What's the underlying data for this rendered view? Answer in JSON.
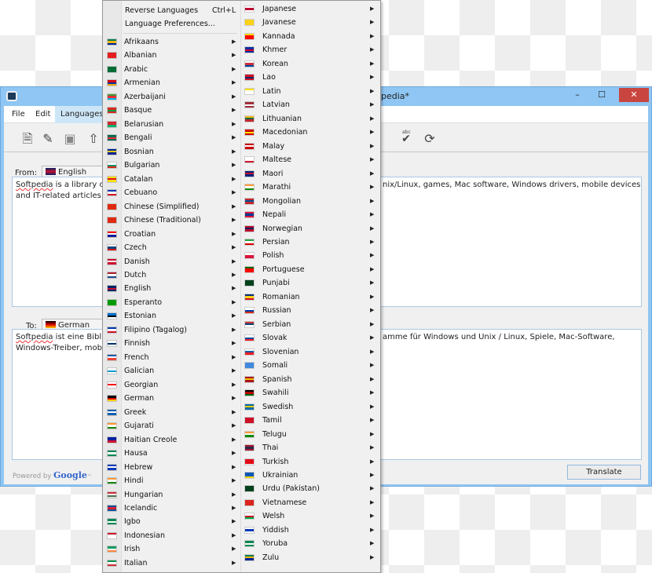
{
  "window": {
    "title": "pedia*",
    "minimize": "–",
    "maximize": "☐",
    "close": "✕"
  },
  "menubar": {
    "items": [
      "File",
      "Edit",
      "Languages"
    ],
    "active": "Languages"
  },
  "toolbar": {
    "icons": [
      "new-document-icon",
      "edit-document-icon",
      "save-icon",
      "export-icon",
      "spellcheck-icon",
      "refresh-icon"
    ],
    "spellcheck_label": "abc"
  },
  "source": {
    "label": "From:",
    "language": "English",
    "flag": [
      "#012169",
      "#c8102e",
      "#012169"
    ],
    "text_left": [
      "Softpedia",
      " is a library of"
    ],
    "text_left2": "and IT-related articles.",
    "text_right": "nix/Linux, games, Mac software, Windows drivers, mobile devices"
  },
  "target": {
    "label": "To:",
    "language": "German",
    "flag": [
      "#000000",
      "#dd0000",
      "#ffce00"
    ],
    "text_left": [
      "Softpedia",
      " ist eine Biblio"
    ],
    "text_left2": "Windows-Treiber, mobi",
    "text_right": "amme für Windows und Unix / Linux, Spiele, Mac-Software,"
  },
  "footer": {
    "powered_by": "Powered by",
    "google": "Google",
    "tm": "™",
    "translate": "Translate"
  },
  "menu": {
    "reverse": {
      "label": "Reverse Languages",
      "shortcut": "Ctrl+L"
    },
    "preferences": {
      "label": "Language Preferences..."
    },
    "left": [
      {
        "label": "Afrikaans",
        "flag": [
          "#007a4d",
          "#ffb612",
          "#002395"
        ]
      },
      {
        "label": "Albanian",
        "flag": [
          "#e41e20",
          "#e41e20",
          "#e41e20"
        ]
      },
      {
        "label": "Arabic",
        "flag": [
          "#006c35",
          "#006c35",
          "#006c35"
        ]
      },
      {
        "label": "Armenian",
        "flag": [
          "#d90012",
          "#0033a0",
          "#f2a800"
        ]
      },
      {
        "label": "Azerbaijani",
        "flag": [
          "#3f9c35",
          "#ed2939",
          "#00b9e4"
        ]
      },
      {
        "label": "Basque",
        "flag": [
          "#d52b1e",
          "#009b48",
          "#d52b1e"
        ]
      },
      {
        "label": "Belarusian",
        "flag": [
          "#d22730",
          "#d22730",
          "#00af66"
        ]
      },
      {
        "label": "Bengali",
        "flag": [
          "#006a4e",
          "#f42a41",
          "#006a4e"
        ]
      },
      {
        "label": "Bosnian",
        "flag": [
          "#002395",
          "#fecb00",
          "#002395"
        ]
      },
      {
        "label": "Bulgarian",
        "flag": [
          "#ffffff",
          "#00966e",
          "#d62612"
        ]
      },
      {
        "label": "Catalan",
        "flag": [
          "#fcdd09",
          "#da121a",
          "#fcdd09"
        ]
      },
      {
        "label": "Cebuano",
        "flag": [
          "#0038a8",
          "#ffffff",
          "#ce1126"
        ]
      },
      {
        "label": "Chinese (Simplified)",
        "flag": [
          "#de2910",
          "#de2910",
          "#de2910"
        ]
      },
      {
        "label": "Chinese (Traditional)",
        "flag": [
          "#de2910",
          "#de2910",
          "#de2910"
        ]
      },
      {
        "label": "Croatian",
        "flag": [
          "#ff0000",
          "#ffffff",
          "#171796"
        ]
      },
      {
        "label": "Czech",
        "flag": [
          "#ffffff",
          "#11457e",
          "#d7141a"
        ]
      },
      {
        "label": "Danish",
        "flag": [
          "#c8102e",
          "#ffffff",
          "#c8102e"
        ]
      },
      {
        "label": "Dutch",
        "flag": [
          "#ae1c28",
          "#ffffff",
          "#21468b"
        ]
      },
      {
        "label": "English",
        "flag": [
          "#012169",
          "#c8102e",
          "#012169"
        ]
      },
      {
        "label": "Esperanto",
        "flag": [
          "#009900",
          "#009900",
          "#009900"
        ]
      },
      {
        "label": "Estonian",
        "flag": [
          "#0072ce",
          "#000000",
          "#ffffff"
        ]
      },
      {
        "label": "Filipino (Tagalog)",
        "flag": [
          "#0038a8",
          "#ffffff",
          "#ce1126"
        ]
      },
      {
        "label": "Finnish",
        "flag": [
          "#ffffff",
          "#002f6c",
          "#ffffff"
        ]
      },
      {
        "label": "French",
        "flag": [
          "#0055a4",
          "#ffffff",
          "#ef4135"
        ]
      },
      {
        "label": "Galician",
        "flag": [
          "#ffffff",
          "#0099cc",
          "#ffffff"
        ]
      },
      {
        "label": "Georgian",
        "flag": [
          "#ffffff",
          "#ff0000",
          "#ffffff"
        ]
      },
      {
        "label": "German",
        "flag": [
          "#000000",
          "#dd0000",
          "#ffce00"
        ]
      },
      {
        "label": "Greek",
        "flag": [
          "#0d5eaf",
          "#ffffff",
          "#0d5eaf"
        ]
      },
      {
        "label": "Gujarati",
        "flag": [
          "#ff9933",
          "#ffffff",
          "#138808"
        ]
      },
      {
        "label": "Haitian Creole",
        "flag": [
          "#00209f",
          "#00209f",
          "#d21034"
        ]
      },
      {
        "label": "Hausa",
        "flag": [
          "#008751",
          "#ffffff",
          "#008751"
        ]
      },
      {
        "label": "Hebrew",
        "flag": [
          "#0038b8",
          "#ffffff",
          "#0038b8"
        ]
      },
      {
        "label": "Hindi",
        "flag": [
          "#ff9933",
          "#ffffff",
          "#138808"
        ]
      },
      {
        "label": "Hungarian",
        "flag": [
          "#ce2939",
          "#ffffff",
          "#477050"
        ]
      },
      {
        "label": "Icelandic",
        "flag": [
          "#02529c",
          "#dc1e35",
          "#02529c"
        ]
      },
      {
        "label": "Igbo",
        "flag": [
          "#008751",
          "#ffffff",
          "#008751"
        ]
      },
      {
        "label": "Indonesian",
        "flag": [
          "#ce1126",
          "#ffffff",
          "#ffffff"
        ]
      },
      {
        "label": "Irish",
        "flag": [
          "#169b62",
          "#ffffff",
          "#ff883e"
        ]
      },
      {
        "label": "Italian",
        "flag": [
          "#009246",
          "#ffffff",
          "#ce2b37"
        ]
      }
    ],
    "right": [
      {
        "label": "Japanese",
        "flag": [
          "#ffffff",
          "#bc002d",
          "#ffffff"
        ]
      },
      {
        "label": "Javanese",
        "flag": [
          "#fcd116",
          "#fcd116",
          "#fcd116"
        ]
      },
      {
        "label": "Kannada",
        "flag": [
          "#ffd700",
          "#ff0000",
          "#ff0000"
        ]
      },
      {
        "label": "Khmer",
        "flag": [
          "#032ea1",
          "#e00025",
          "#032ea1"
        ]
      },
      {
        "label": "Korean",
        "flag": [
          "#ffffff",
          "#cd2e3a",
          "#0047a0"
        ]
      },
      {
        "label": "Lao",
        "flag": [
          "#ce1126",
          "#002868",
          "#ce1126"
        ]
      },
      {
        "label": "Latin",
        "flag": [
          "#ffe000",
          "#ffffff",
          "#ffffff"
        ]
      },
      {
        "label": "Latvian",
        "flag": [
          "#9e3039",
          "#ffffff",
          "#9e3039"
        ]
      },
      {
        "label": "Lithuanian",
        "flag": [
          "#fdb913",
          "#006a44",
          "#c1272d"
        ]
      },
      {
        "label": "Macedonian",
        "flag": [
          "#d20000",
          "#ffe600",
          "#d20000"
        ]
      },
      {
        "label": "Malay",
        "flag": [
          "#cc0001",
          "#ffffff",
          "#cc0001"
        ]
      },
      {
        "label": "Maltese",
        "flag": [
          "#ffffff",
          "#ffffff",
          "#cf142b"
        ]
      },
      {
        "label": "Maori",
        "flag": [
          "#00247d",
          "#cc142b",
          "#00247d"
        ]
      },
      {
        "label": "Marathi",
        "flag": [
          "#ff9933",
          "#ffffff",
          "#138808"
        ]
      },
      {
        "label": "Mongolian",
        "flag": [
          "#c4272f",
          "#015197",
          "#c4272f"
        ]
      },
      {
        "label": "Nepali",
        "flag": [
          "#dc143c",
          "#003893",
          "#dc143c"
        ]
      },
      {
        "label": "Norwegian",
        "flag": [
          "#ba0c2f",
          "#00205b",
          "#ba0c2f"
        ]
      },
      {
        "label": "Persian",
        "flag": [
          "#239f40",
          "#ffffff",
          "#da0000"
        ]
      },
      {
        "label": "Polish",
        "flag": [
          "#ffffff",
          "#dc143c",
          "#dc143c"
        ]
      },
      {
        "label": "Portuguese",
        "flag": [
          "#006600",
          "#ff0000",
          "#ff0000"
        ]
      },
      {
        "label": "Punjabi",
        "flag": [
          "#01411c",
          "#01411c",
          "#01411c"
        ]
      },
      {
        "label": "Romanian",
        "flag": [
          "#002b7f",
          "#fcd116",
          "#ce1126"
        ]
      },
      {
        "label": "Russian",
        "flag": [
          "#ffffff",
          "#0039a6",
          "#d52b1e"
        ]
      },
      {
        "label": "Serbian",
        "flag": [
          "#c6363c",
          "#0c4076",
          "#ffffff"
        ]
      },
      {
        "label": "Slovak",
        "flag": [
          "#ffffff",
          "#0b4ea2",
          "#ee1c25"
        ]
      },
      {
        "label": "Slovenian",
        "flag": [
          "#ffffff",
          "#005da4",
          "#ed1c24"
        ]
      },
      {
        "label": "Somali",
        "flag": [
          "#4189dd",
          "#4189dd",
          "#4189dd"
        ]
      },
      {
        "label": "Spanish",
        "flag": [
          "#aa151b",
          "#f1bf00",
          "#aa151b"
        ]
      },
      {
        "label": "Swahili",
        "flag": [
          "#000000",
          "#bb0000",
          "#006600"
        ]
      },
      {
        "label": "Swedish",
        "flag": [
          "#006aa7",
          "#fecc00",
          "#006aa7"
        ]
      },
      {
        "label": "Tamil",
        "flag": [
          "#ce1126",
          "#ce1126",
          "#ce1126"
        ]
      },
      {
        "label": "Telugu",
        "flag": [
          "#ff9933",
          "#ffffff",
          "#138808"
        ]
      },
      {
        "label": "Thai",
        "flag": [
          "#a51931",
          "#2d2a4a",
          "#a51931"
        ]
      },
      {
        "label": "Turkish",
        "flag": [
          "#e30a17",
          "#e30a17",
          "#e30a17"
        ]
      },
      {
        "label": "Ukrainian",
        "flag": [
          "#0057b7",
          "#0057b7",
          "#ffd700"
        ]
      },
      {
        "label": "Urdu (Pakistan)",
        "flag": [
          "#01411c",
          "#01411c",
          "#01411c"
        ]
      },
      {
        "label": "Vietnamese",
        "flag": [
          "#da251d",
          "#da251d",
          "#da251d"
        ]
      },
      {
        "label": "Welsh",
        "flag": [
          "#ffffff",
          "#c8102e",
          "#00b140"
        ]
      },
      {
        "label": "Yiddish",
        "flag": [
          "#ffffff",
          "#0038b8",
          "#ffffff"
        ]
      },
      {
        "label": "Yoruba",
        "flag": [
          "#008751",
          "#ffffff",
          "#008751"
        ]
      },
      {
        "label": "Zulu",
        "flag": [
          "#007a4d",
          "#ffb612",
          "#002395"
        ]
      }
    ]
  }
}
